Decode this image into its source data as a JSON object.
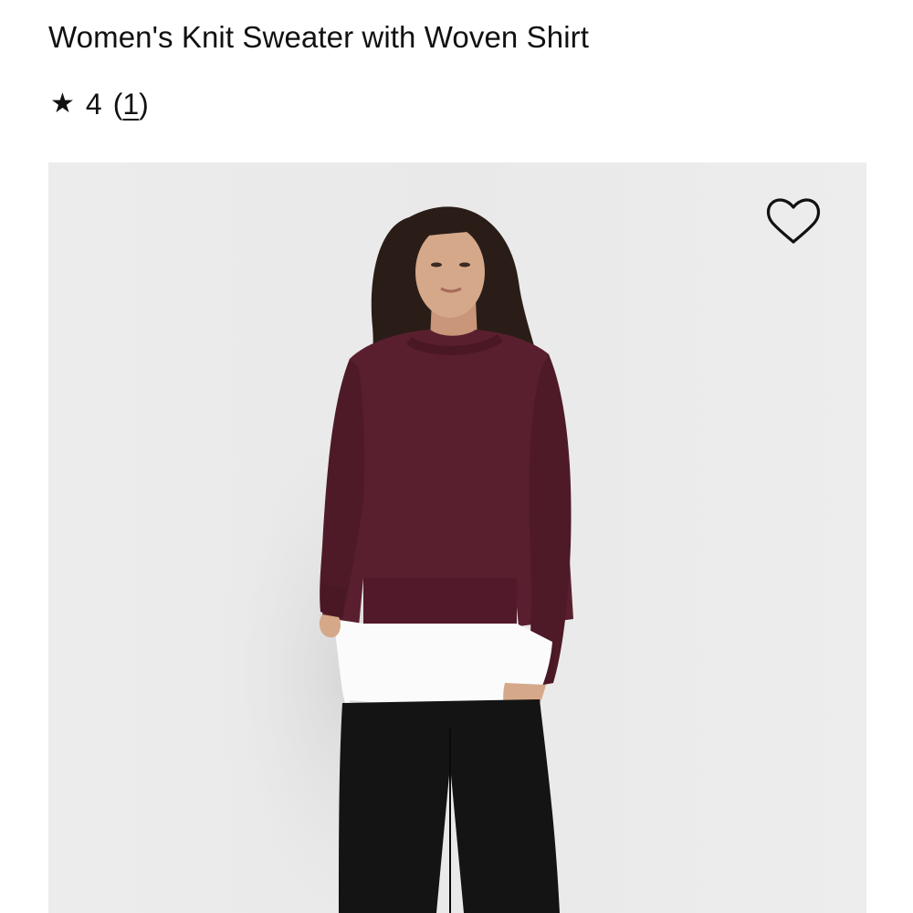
{
  "product": {
    "title": "Women's Knit Sweater with Woven Shirt",
    "rating": {
      "star_icon": "★",
      "score": "4",
      "count_open": "(",
      "count": "1",
      "count_close": ")"
    }
  },
  "image": {
    "background_color": "#ebebeb",
    "sweater_color": "#5a1f2e",
    "shirt_color": "#fbfbfb",
    "pants_color": "#141414",
    "hair_color": "#2a1d17",
    "skin_color": "#d6a88a"
  },
  "wishlist": {
    "icon": "heart-outline-icon"
  }
}
